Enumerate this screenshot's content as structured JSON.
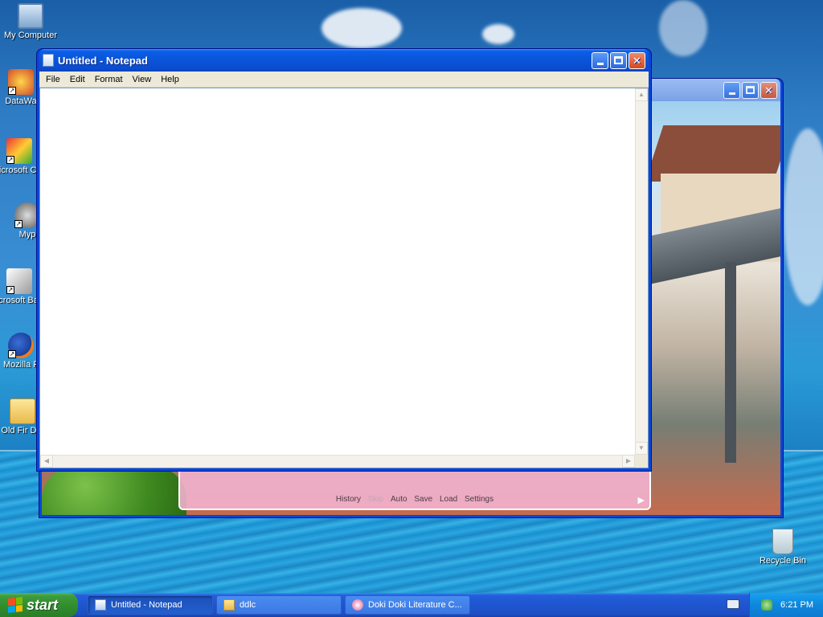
{
  "desktop": {
    "icons": [
      {
        "label": "My Computer",
        "icon": "my-computer-icon"
      },
      {
        "label": "DataWa",
        "icon": "shortcut-app-icon"
      },
      {
        "label": "Microsoft C++",
        "icon": "visual-cpp-icon"
      },
      {
        "label": "Myp",
        "icon": "raccoon-app-icon"
      },
      {
        "label": "Microsoft Basic",
        "icon": "visual-basic-icon"
      },
      {
        "label": "Mozilla F",
        "icon": "firefox-icon"
      },
      {
        "label": "Old Fir Dat",
        "icon": "folder-icon"
      },
      {
        "label": "Recycle Bin",
        "icon": "recycle-bin-icon"
      }
    ]
  },
  "notepad": {
    "title": "Untitled - Notepad",
    "menu": [
      "File",
      "Edit",
      "Format",
      "View",
      "Help"
    ],
    "content": ""
  },
  "game_window": {
    "quick_menu": [
      "History",
      "Skip",
      "Auto",
      "Save",
      "Load",
      "Settings"
    ],
    "disabled_item": "Skip"
  },
  "taskbar": {
    "start_label": "start",
    "tasks": [
      {
        "label": "Untitled - Notepad",
        "icon": "notepad-icon",
        "active": true
      },
      {
        "label": "ddlc",
        "icon": "folder-icon",
        "active": false
      },
      {
        "label": "Doki Doki Literature C...",
        "icon": "ddlc-icon",
        "active": false
      }
    ],
    "clock": "6:21 PM"
  },
  "colors": {
    "title_bar": "#0a54d8",
    "start_button": "#3c9a3a",
    "taskbar": "#245edb",
    "tray": "#0e87dc"
  }
}
